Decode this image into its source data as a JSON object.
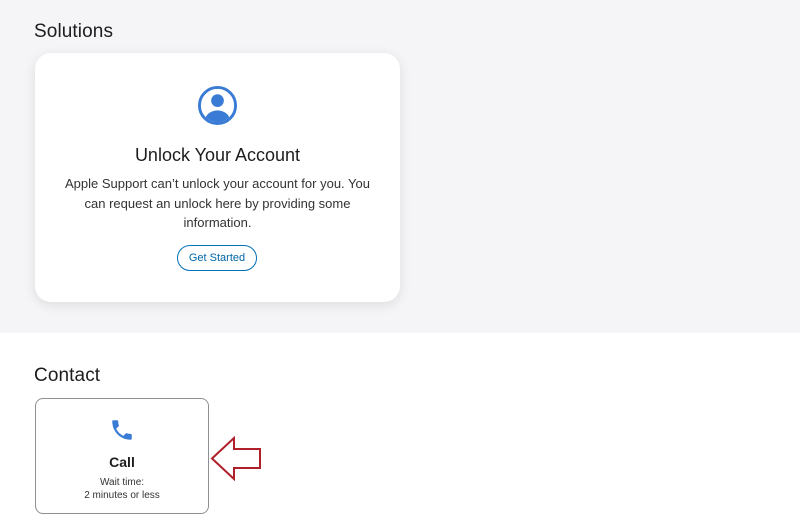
{
  "solutions": {
    "heading": "Solutions",
    "card": {
      "icon": "account-circle-icon",
      "title": "Unlock Your Account",
      "description": "Apple Support can’t unlock your account for you. You can request an unlock here by providing some information.",
      "button_label": "Get Started"
    }
  },
  "contact": {
    "heading": "Contact",
    "options": [
      {
        "icon": "phone-icon",
        "title": "Call",
        "wait_label": "Wait time:",
        "wait_value": "2 minutes or less"
      }
    ]
  },
  "colors": {
    "solutions_background": "#f5f5f7",
    "accent_blue": "#3a7bd5",
    "button_border": "#0071b8",
    "annotation_arrow": "#b0202a"
  }
}
